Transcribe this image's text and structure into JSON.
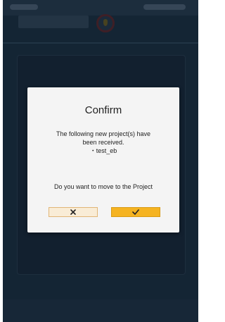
{
  "dialog": {
    "title": "Confirm",
    "message_line1": "The following new project(s) have",
    "message_line2": "been received.",
    "project_item": "・test_eb",
    "question": "Do you want to move to the Project"
  },
  "buttons": {
    "cancel_icon": "close-icon",
    "confirm_icon": "checkmark-icon"
  },
  "colors": {
    "background": "#1e3548",
    "dialog": "#f4f4f4",
    "cancel_button": "#f9ecd6",
    "cancel_border": "#e1b677",
    "confirm_button": "#f5b321"
  }
}
